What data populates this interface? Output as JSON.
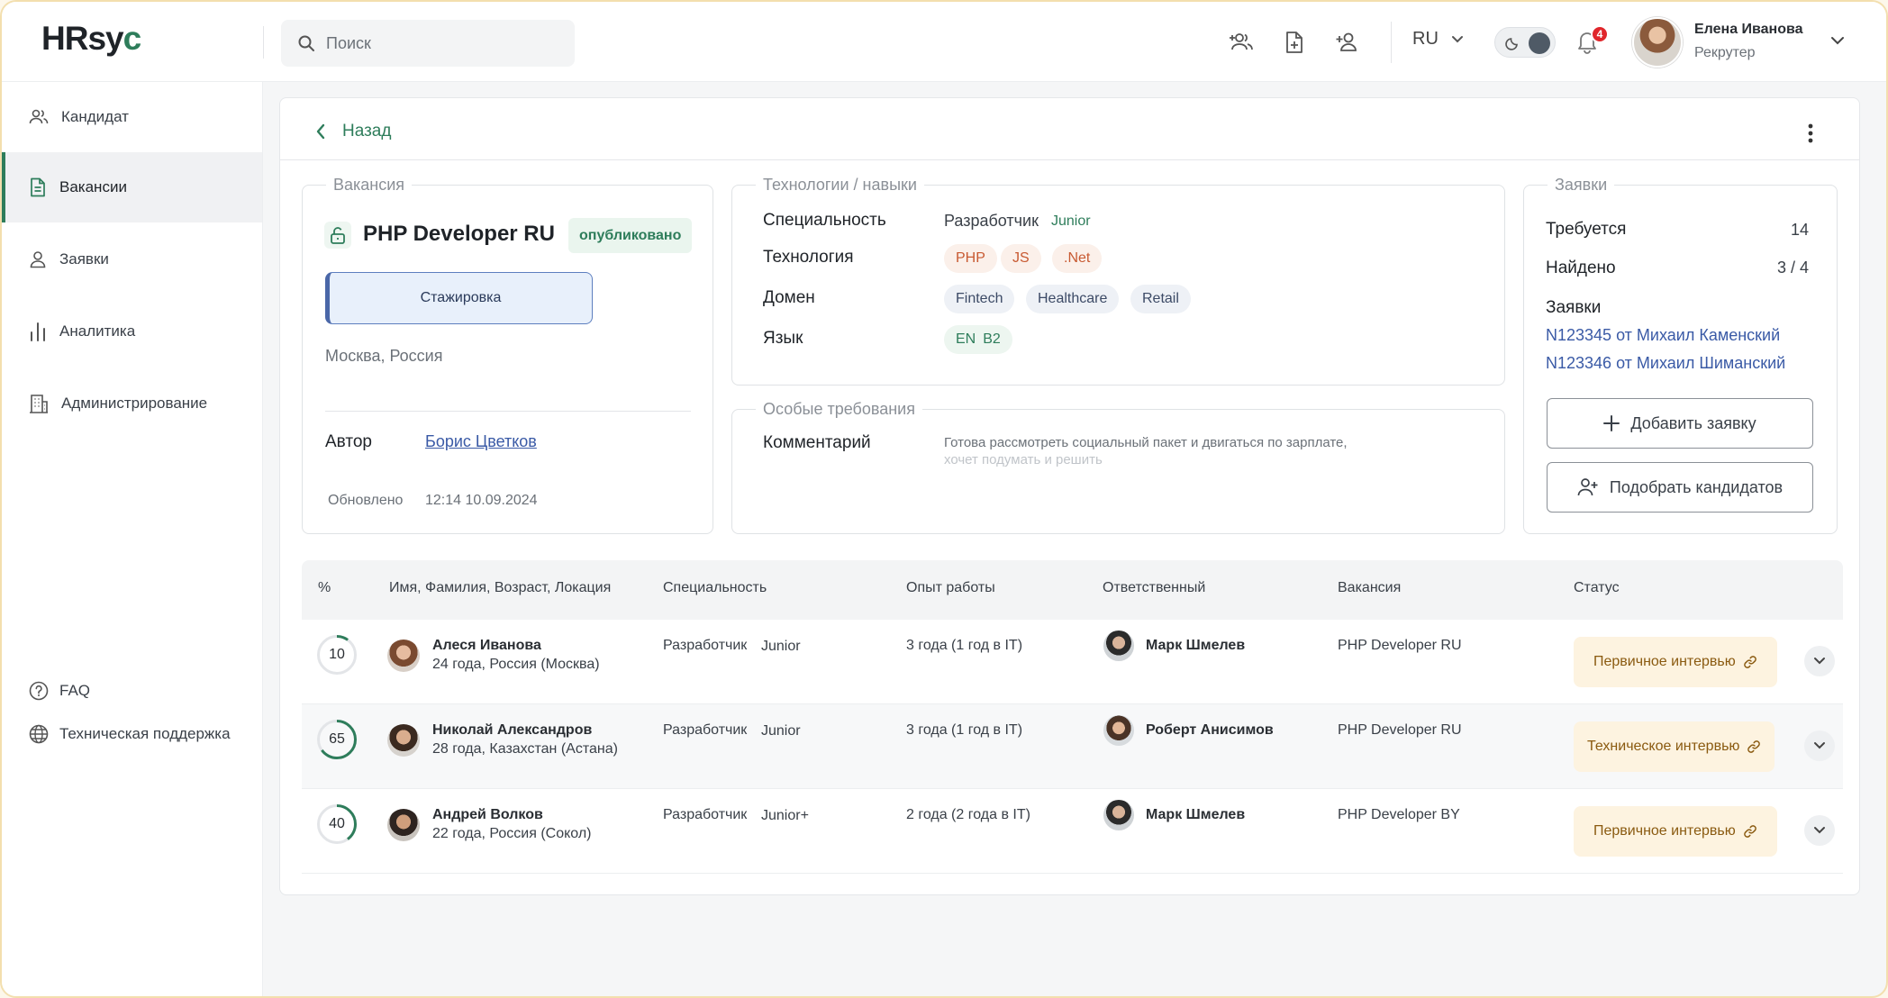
{
  "header": {
    "logo_prefix": "HRsy",
    "logo_accent": "c",
    "search_placeholder": "Поиск",
    "icons": [
      "users-plus-icon",
      "file-plus-icon",
      "user-plus-icon"
    ],
    "language": "RU",
    "notifications_count": "4",
    "user": {
      "name": "Елена Иванова",
      "role": "Рекрутер"
    }
  },
  "sidebar": {
    "items": [
      {
        "label": "Кандидат",
        "icon": "users-icon"
      },
      {
        "label": "Вакансии",
        "icon": "document-icon",
        "active": true
      },
      {
        "label": "Заявки",
        "icon": "user-icon"
      },
      {
        "label": "Аналитика",
        "icon": "bar-chart-icon"
      },
      {
        "label": "Администрирование",
        "icon": "building-icon"
      }
    ],
    "bottom": [
      {
        "label": "FAQ",
        "icon": "question-icon"
      },
      {
        "label": "Техническая поддержка",
        "icon": "globe-icon"
      }
    ]
  },
  "page": {
    "back_label": "Назад"
  },
  "vacancy": {
    "legend": "Вакансия",
    "title": "PHP Developer RU",
    "status": "опубликовано",
    "type": "Стажировка",
    "location": "Москва, Россия",
    "author_label": "Автор",
    "author": "Борис Цветков",
    "updated_label": "Обновлено",
    "updated": "12:14 10.09.2024"
  },
  "skills": {
    "legend": "Технологии / навыки",
    "specialty_label": "Специальность",
    "specialty": "Разработчик",
    "level": "Junior",
    "technology_label": "Технология",
    "technologies": [
      "PHP",
      "JS",
      ".Net"
    ],
    "domain_label": "Домен",
    "domains": [
      "Fintech",
      "Healthcare",
      "Retail"
    ],
    "language_label": "Язык",
    "language": "EN",
    "language_level": "B2"
  },
  "special": {
    "legend": "Особые требования",
    "comment_label": "Комментарий",
    "comment_line1": "Готова рассмотреть социальный пакет и двигаться по зарплате,",
    "comment_line2": "хочет подумать и решить"
  },
  "requests": {
    "legend": "Заявки",
    "required_label": "Требуется",
    "required": "14",
    "found_label": "Найдено",
    "found": "3 / 4",
    "list_label": "Заявки",
    "links": [
      "N123345 от Михаил Каменский",
      "N123346 от Михаил Шиманский"
    ],
    "add_button": "Добавить заявку",
    "match_button": "Подобрать кандидатов"
  },
  "table": {
    "headers": [
      "%",
      "Имя, Фамилия, Возраст, Локация",
      "Специальность",
      "Опыт работы",
      "Ответственный",
      "Вакансия",
      "Статус"
    ],
    "rows": [
      {
        "percent": "10",
        "name": "Алеся Иванова",
        "meta": "24 года, Россия (Москва)",
        "specialty": "Разработчик",
        "level": "Junior",
        "experience": "3 года (1 год в IT)",
        "responsible": "Марк Шмелев",
        "vacancy": "PHP Developer RU",
        "status": "Первичное интервью"
      },
      {
        "percent": "65",
        "name": "Николай Александров",
        "meta": "28 года, Казахстан (Астана)",
        "specialty": "Разработчик",
        "level": "Junior",
        "experience": "3 года (1 год в IT)",
        "responsible": "Роберт Анисимов",
        "vacancy": "PHP Developer RU",
        "status": "Техническое интервью"
      },
      {
        "percent": "40",
        "name": "Андрей Волков",
        "meta": "22 года, Россия (Сокол)",
        "specialty": "Разработчик",
        "level": "Junior+",
        "experience": "2 года (2 года в IT)",
        "responsible": "Марк Шмелев",
        "vacancy": "PHP Developer BY",
        "status": "Первичное интервью"
      }
    ]
  },
  "colors": {
    "accent": "#2e7d5b",
    "link": "#3a5aa6",
    "status_bg": "#fdf3e0",
    "badge": "#e0262b"
  }
}
